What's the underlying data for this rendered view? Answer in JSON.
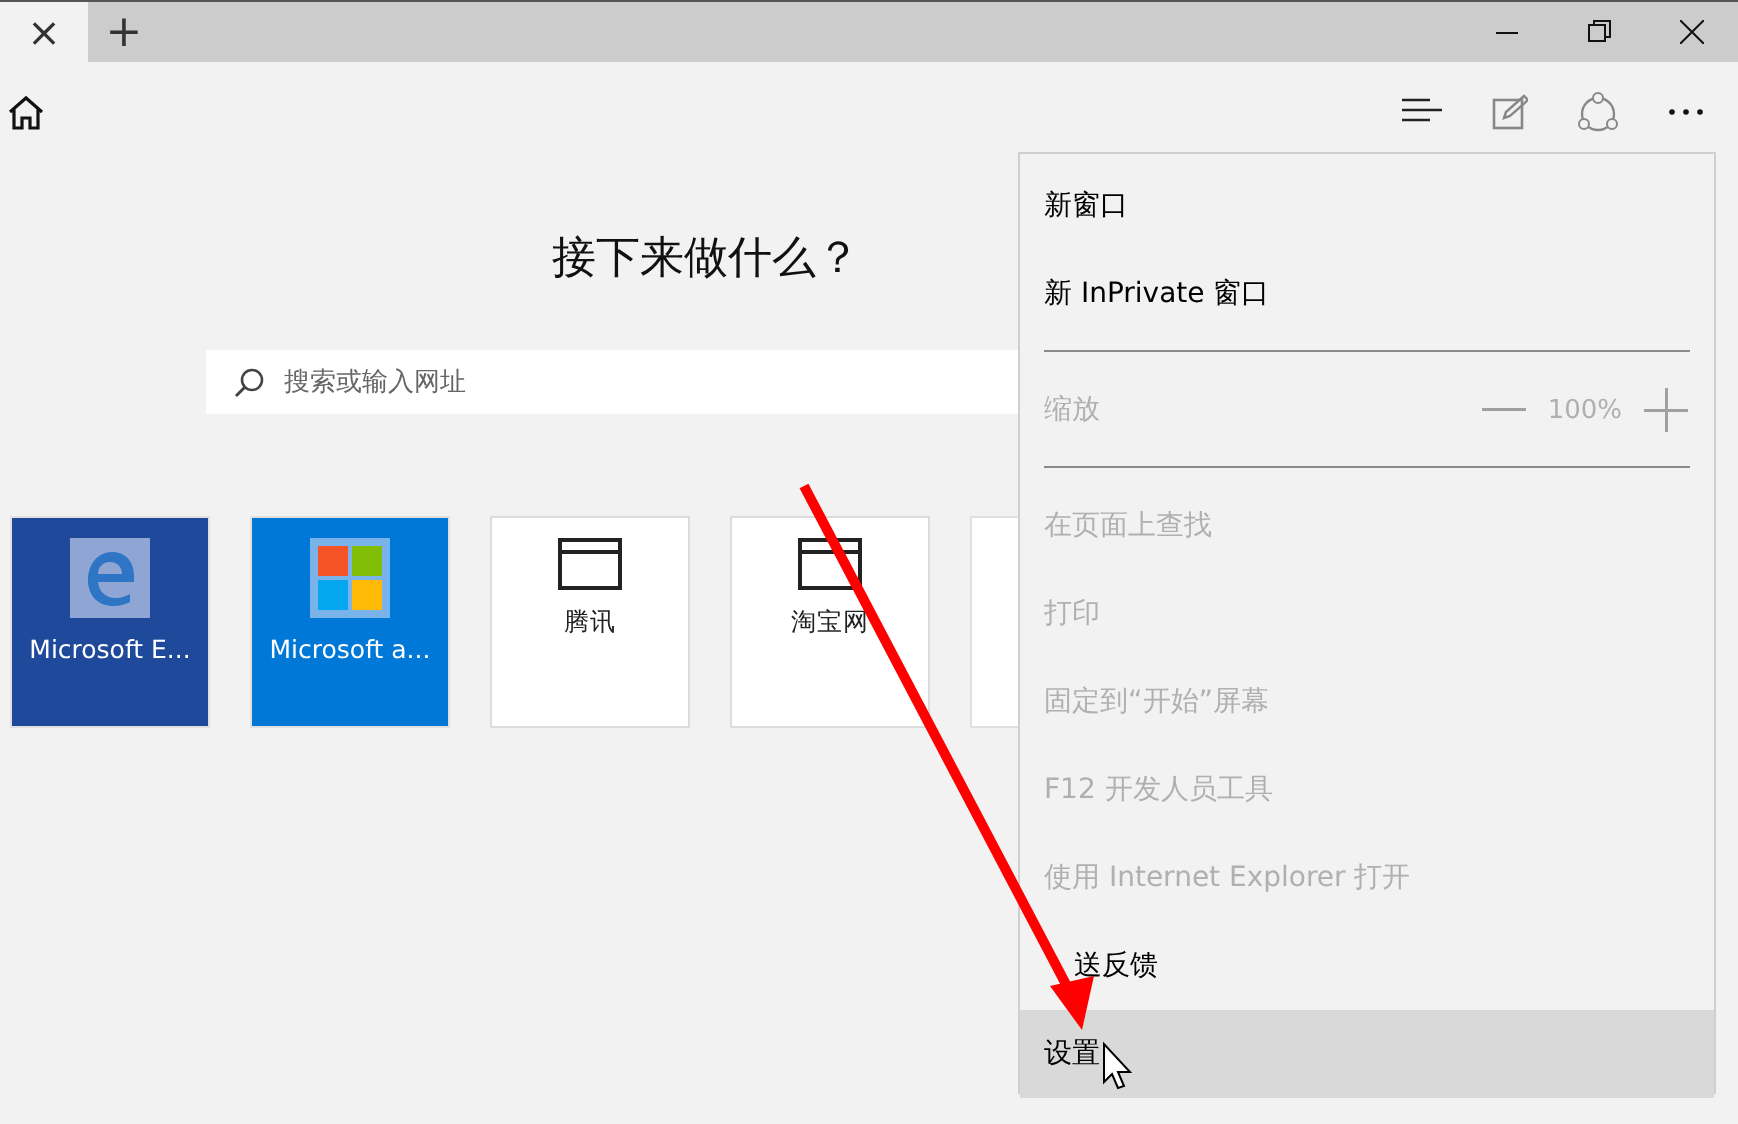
{
  "tabs": [
    {
      "selected": true,
      "close": "×"
    }
  ],
  "new_tab": "+",
  "page": {
    "heading": "接下来做什么？",
    "search": {
      "placeholder": "搜索或输入网址"
    },
    "tiles": [
      {
        "kind": "edge",
        "label": "Microsoft E..."
      },
      {
        "kind": "store",
        "label": "Microsoft a..."
      },
      {
        "kind": "site",
        "label": "腾讯"
      },
      {
        "kind": "site",
        "label": "淘宝网"
      },
      {
        "kind": "blank"
      }
    ]
  },
  "menu": {
    "items": [
      {
        "kind": "item",
        "label": "新窗口",
        "disabled": false,
        "selected": false
      },
      {
        "kind": "item",
        "label": "新 InPrivate 窗口",
        "disabled": false,
        "selected": false
      },
      {
        "kind": "separator"
      },
      {
        "kind": "zoom",
        "label": "缩放",
        "value": "100%",
        "disabled": true
      },
      {
        "kind": "separator"
      },
      {
        "kind": "item",
        "label": "在页面上查找",
        "disabled": true,
        "selected": false
      },
      {
        "kind": "item",
        "label": "打印",
        "disabled": true,
        "selected": false
      },
      {
        "kind": "item",
        "label": "固定到“开始”屏幕",
        "disabled": true,
        "selected": false
      },
      {
        "kind": "item",
        "label": "F12 开发人员工具",
        "disabled": true,
        "selected": false
      },
      {
        "kind": "item",
        "label": "使用 Internet Explorer 打开",
        "disabled": true,
        "selected": false
      },
      {
        "kind": "item",
        "label": "送反馈",
        "disabled": false,
        "selected": false
      },
      {
        "kind": "item",
        "label": "设置",
        "disabled": false,
        "selected": true
      }
    ]
  }
}
